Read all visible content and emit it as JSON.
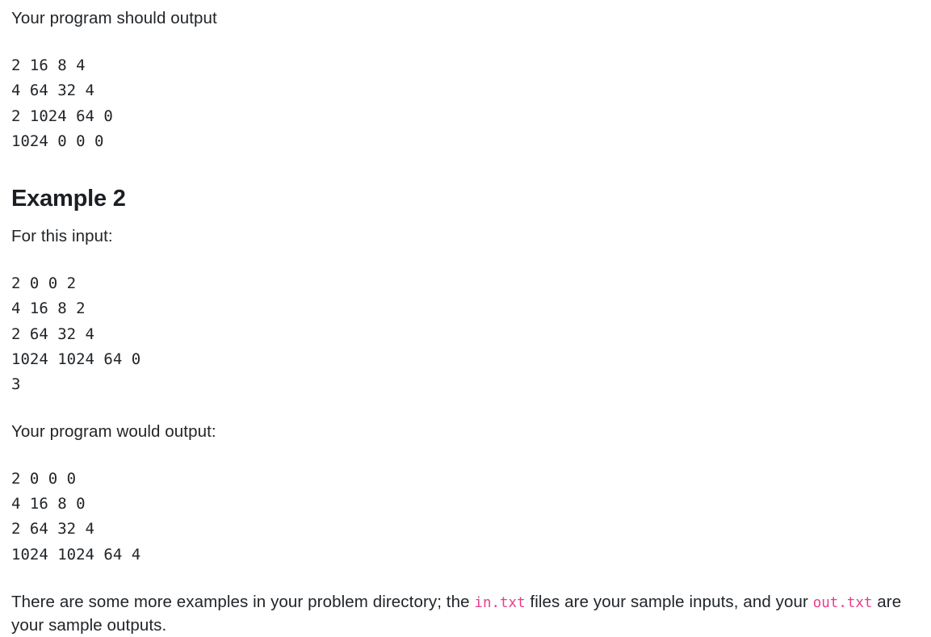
{
  "document": {
    "background_color": "#ffffff",
    "text_color": "#212529",
    "inline_code_color": "#e83e8c",
    "blocks": {
      "intro_label": "Your program should output",
      "example1_output": "2 16 8 4\n4 64 32 4\n2 1024 64 0\n1024 0 0 0",
      "example2_heading": "Example 2",
      "example2_input_label": "For this input:",
      "example2_input": "2 0 0 2\n4 16 8 2\n2 64 32 4\n1024 1024 64 0\n3",
      "example2_output_label": "Your program would output:",
      "example2_output": "2 0 0 0\n4 16 8 0\n2 64 32 4\n1024 1024 64 4",
      "footer": {
        "text_part1": "There are some more examples in your problem directory; the ",
        "code1": "in.txt",
        "text_part2": " files are your sample inputs, and your ",
        "code2": "out.txt",
        "text_part3": " are your sample outputs."
      }
    }
  }
}
